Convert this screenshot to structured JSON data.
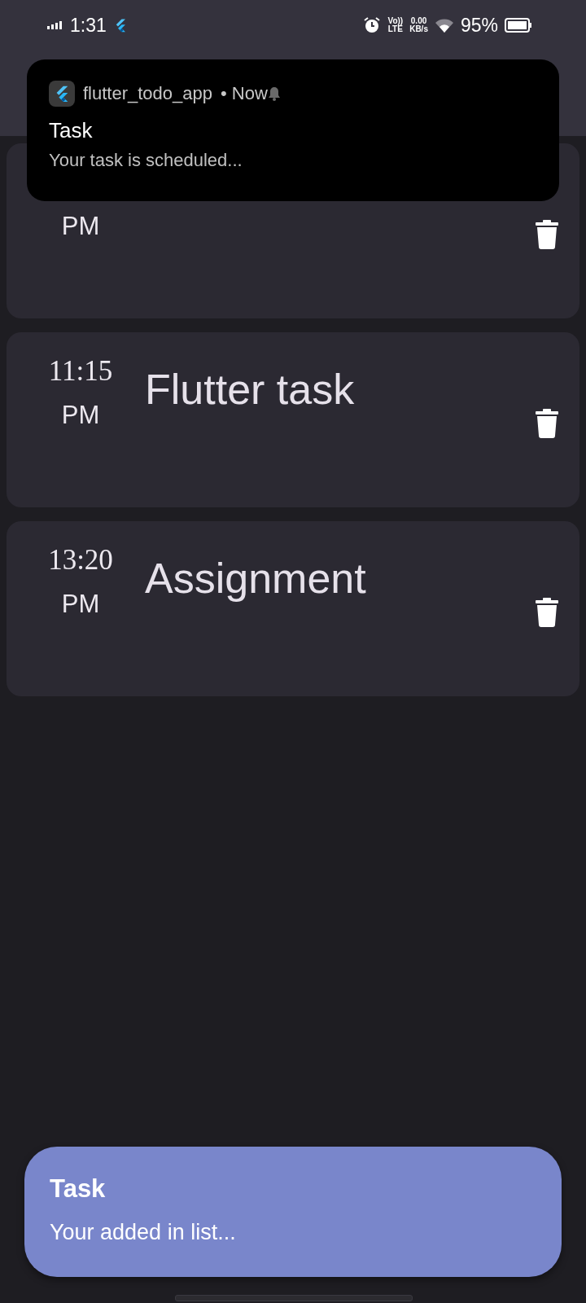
{
  "status_bar": {
    "time": "1:31",
    "volte": [
      "Vo))",
      "LTE"
    ],
    "network_speed": [
      "0.00",
      "KB/s"
    ],
    "battery": "95%"
  },
  "notification": {
    "app_name": "flutter_todo_app",
    "time": "• Now",
    "title": "Task",
    "body": "Your task is scheduled..."
  },
  "tasks": [
    {
      "period": "PM"
    },
    {
      "time": "11:15",
      "period": "PM",
      "title": "Flutter task"
    },
    {
      "time": "13:20",
      "period": "PM",
      "title": "Assignment"
    }
  ],
  "snackbar": {
    "title": "Task",
    "message": "Your added in list..."
  }
}
